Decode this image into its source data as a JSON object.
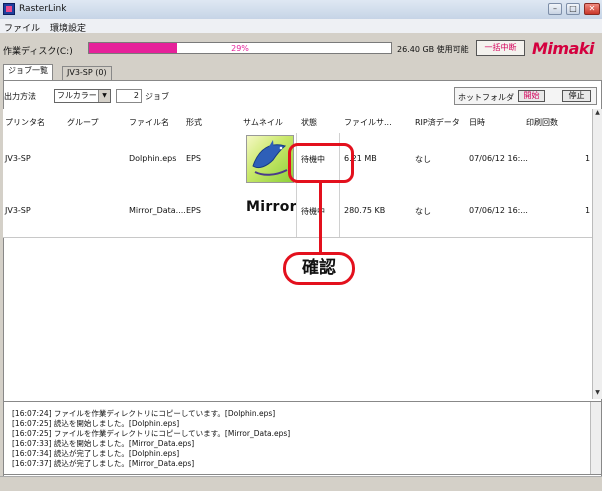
{
  "window": {
    "title": "RasterLink",
    "minimize_glyph": "–",
    "maximize_glyph": "□",
    "close_glyph": "✕"
  },
  "menu": {
    "items": [
      "ファイル",
      "環境設定"
    ]
  },
  "disk": {
    "label": "作業ディスク(C:)",
    "usage_percent": 29,
    "usage_text": "29%",
    "free_text": "26.40 GB 使用可能"
  },
  "toolbar": {
    "stop_all_label": "一括中断",
    "output_method_label": "出力方法",
    "output_method_value": "フルカラー",
    "job_count": "2",
    "job_unit": "ジョブ"
  },
  "brand": {
    "logo_text": "Mimaki"
  },
  "tabs": [
    {
      "label": "ジョブ一覧"
    },
    {
      "label": "JV3-SP (0)"
    }
  ],
  "hotfolder": {
    "label": "ホットフォルダ",
    "start_label": "開始",
    "stop_label": "停止"
  },
  "table": {
    "columns": [
      "プリンタ名",
      "グループ",
      "ファイル名",
      "形式",
      "サムネイル",
      "状態",
      "ファイルサ...",
      "RIP済データ",
      "日時",
      "印刷回数"
    ],
    "rows": [
      {
        "printer": "JV3-SP",
        "group": "",
        "filename": "Dolphin.eps",
        "format": "EPS",
        "thumbnail": "dolphin-image",
        "status": "待機中",
        "filesize": "6.21 MB",
        "rip": "なし",
        "datetime": "07/06/12 16:...",
        "count": "1"
      },
      {
        "printer": "JV3-SP",
        "group": "",
        "filename": "Mirror_Data....",
        "format": "EPS",
        "thumbnail_text": "Mirror",
        "status": "待機中",
        "filesize": "280.75 KB",
        "rip": "なし",
        "datetime": "07/06/12 16:...",
        "count": "1"
      }
    ]
  },
  "log": {
    "lines": [
      "[16:07:24] ファイルを作業ディレクトリにコピーしています。[Dolphin.eps]",
      "[16:07:25] 読込を開始しました。[Dolphin.eps]",
      "[16:07:25] ファイルを作業ディレクトリにコピーしています。[Mirror_Data.eps]",
      "[16:07:33] 読込を開始しました。[Mirror_Data.eps]",
      "[16:07:34] 読込が完了しました。[Dolphin.eps]",
      "[16:07:37] 読込が完了しました。[Mirror_Data.eps]"
    ]
  },
  "annotation": {
    "label": "確認",
    "color": "#e3101d"
  },
  "colors": {
    "accent": "#e6219a",
    "brand": "#d4003e"
  },
  "icons": [
    "app-icon",
    "dropdown-arrow-icon",
    "scroll-up-icon",
    "scroll-down-icon"
  ]
}
